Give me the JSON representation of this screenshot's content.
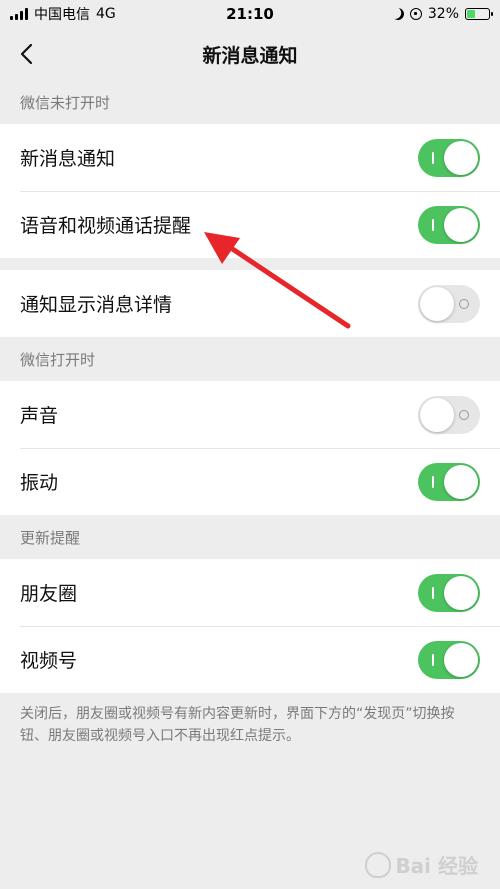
{
  "status_bar": {
    "carrier": "中国电信",
    "network": "4G",
    "time": "21:10",
    "battery": "32%"
  },
  "nav": {
    "title": "新消息通知"
  },
  "sections": [
    {
      "label": "微信未打开时",
      "rows": [
        {
          "label": "新消息通知",
          "on": true
        },
        {
          "label": "语音和视频通话提醒",
          "on": true
        }
      ]
    },
    {
      "label": "",
      "rows": [
        {
          "label": "通知显示消息详情",
          "on": false
        }
      ]
    },
    {
      "label": "微信打开时",
      "rows": [
        {
          "label": "声音",
          "on": false
        },
        {
          "label": "振动",
          "on": true
        }
      ]
    },
    {
      "label": "更新提醒",
      "rows": [
        {
          "label": "朋友圈",
          "on": true
        },
        {
          "label": "视频号",
          "on": true
        }
      ]
    }
  ],
  "footnote": "关闭后，朋友圈或视频号有新内容更新时，界面下方的“发现页”切换按钮、朋友圈或视频号入口不再出现红点提示。",
  "watermark": "Bai 经验",
  "colors": {
    "toggle_on": "#4cc35f",
    "toggle_off": "#e6e6e6",
    "annotation_arrow": "#e8262a"
  }
}
